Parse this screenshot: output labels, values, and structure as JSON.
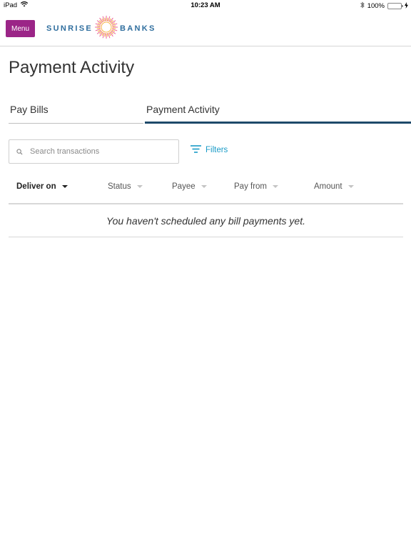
{
  "status_bar": {
    "device": "iPad",
    "time": "10:23 AM",
    "battery": "100%",
    "battery_level": 1.0
  },
  "header": {
    "menu_label": "Menu",
    "logo": {
      "word_left": "SUNRISE",
      "word_right": "BANKS"
    }
  },
  "page_title": "Payment Activity",
  "tabs": [
    {
      "label": "Pay Bills",
      "active": false
    },
    {
      "label": "Payment Activity",
      "active": true
    }
  ],
  "search": {
    "placeholder": "Search transactions"
  },
  "filters_label": "Filters",
  "table": {
    "columns": [
      {
        "label": "Deliver on",
        "sorted": true
      },
      {
        "label": "Status",
        "sorted": false
      },
      {
        "label": "Payee",
        "sorted": false
      },
      {
        "label": "Pay from",
        "sorted": false
      },
      {
        "label": "Amount",
        "sorted": false
      }
    ],
    "empty_message": "You haven't scheduled any bill payments yet."
  },
  "colors": {
    "menu_button": "#9b2587",
    "brand_blue": "#2f6e9e",
    "tab_active_underline": "#1e4a6a",
    "filters_accent": "#1a9bc7",
    "sunburst_pink": "#e8558f",
    "sunburst_orange": "#f5a623"
  },
  "icons": [
    "wifi-icon",
    "bluetooth-icon",
    "battery-icon",
    "charging-icon",
    "sunburst-logo-icon",
    "search-icon",
    "filter-icon",
    "sort-caret-icon"
  ]
}
